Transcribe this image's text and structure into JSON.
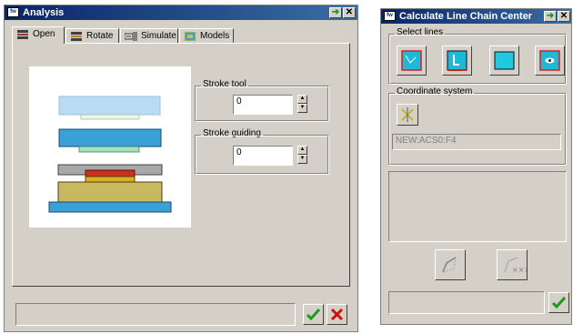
{
  "analysis": {
    "title": "Analysis",
    "tabs": [
      {
        "label": "Open"
      },
      {
        "label": "Rotate"
      },
      {
        "label": "Simulate"
      },
      {
        "label": "Models"
      }
    ],
    "stroke_tool": {
      "label": "Stroke tool",
      "value": "0"
    },
    "stroke_guiding": {
      "label": "Stroke guiding",
      "value": "0"
    },
    "status": ""
  },
  "calc": {
    "title": "Calculate Line Chain Center",
    "select_lines_label": "Select lines",
    "coordinate_system_label": "Coordinate system",
    "coordinate_value": "NEW:ACS0:F4",
    "status": ""
  },
  "colors": {
    "title_start": "#0a246a",
    "title_end": "#3a6ea5",
    "dialog_bg": "#d4d0c8",
    "ok_green": "#1a9a1a",
    "cancel_red": "#d01010",
    "part_blue": "#3aa0d8"
  },
  "icons": {
    "minimize": "green-arrow-icon",
    "close": "x-icon",
    "ok": "checkmark-icon",
    "cancel": "x-icon"
  }
}
